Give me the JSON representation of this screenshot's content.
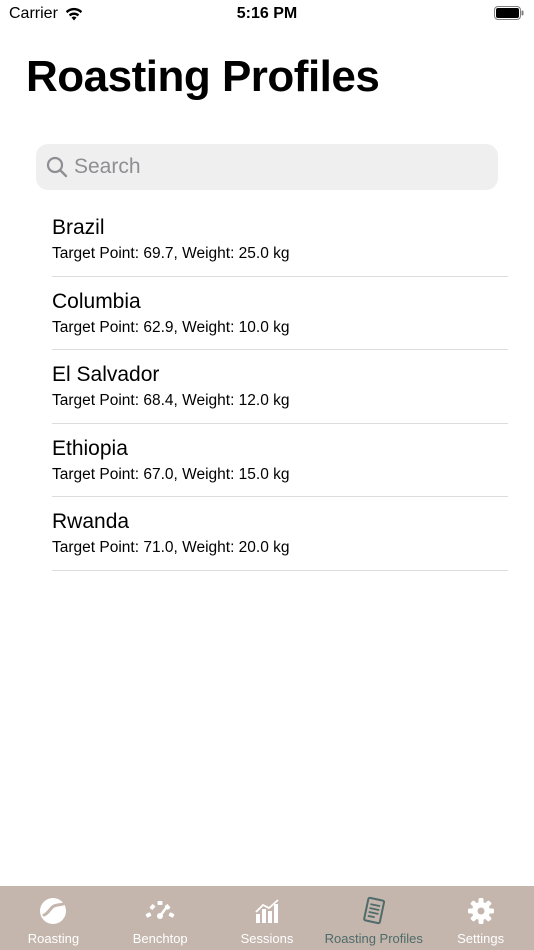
{
  "status_bar": {
    "carrier": "Carrier",
    "time": "5:16 PM"
  },
  "header": {
    "title": "Roasting Profiles"
  },
  "search": {
    "placeholder": "Search",
    "value": ""
  },
  "profiles": [
    {
      "name": "Brazil",
      "detail": "Target Point: 69.7, Weight: 25.0 kg"
    },
    {
      "name": "Columbia",
      "detail": "Target Point: 62.9, Weight: 10.0 kg"
    },
    {
      "name": "El Salvador",
      "detail": "Target Point: 68.4, Weight: 12.0 kg"
    },
    {
      "name": "Ethiopia",
      "detail": "Target Point: 67.0, Weight: 15.0 kg"
    },
    {
      "name": "Rwanda",
      "detail": "Target Point: 71.0, Weight: 20.0 kg"
    }
  ],
  "tab_bar": {
    "items": [
      {
        "label": "Roasting",
        "icon": "coffee-bean-icon"
      },
      {
        "label": "Benchtop",
        "icon": "gauge-icon"
      },
      {
        "label": "Sessions",
        "icon": "bar-chart-icon"
      },
      {
        "label": "Roasting Profiles",
        "icon": "document-icon"
      },
      {
        "label": "Settings",
        "icon": "gear-icon"
      }
    ],
    "active_index": 3
  },
  "colors": {
    "tab_bar_bg": "#c4b6ad",
    "tab_inactive": "#ffffff",
    "tab_active": "#4f6b6a",
    "search_bg": "#efefef",
    "separator": "#dcdcdc"
  }
}
